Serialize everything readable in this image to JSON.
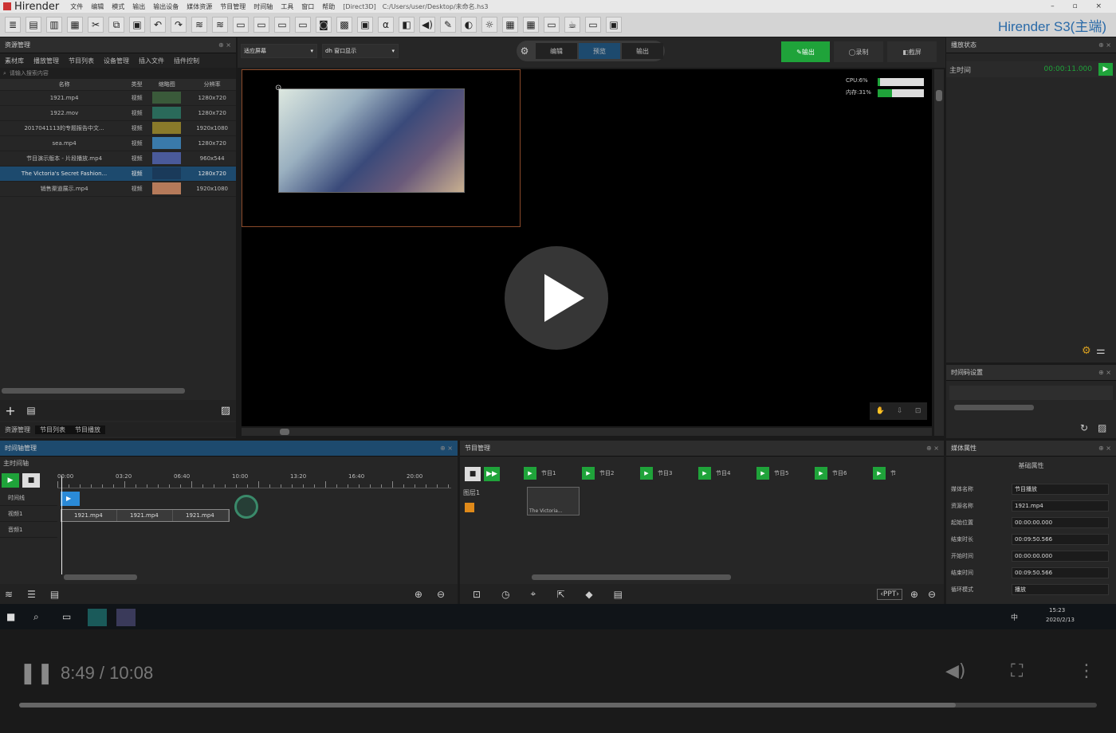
{
  "window": {
    "app_name": "Hirender",
    "menu": [
      "文件",
      "编辑",
      "模式",
      "输出",
      "输出设备",
      "媒体资源",
      "节目管理",
      "时间轴",
      "工具",
      "窗口",
      "帮助"
    ],
    "renderer": "[Direct3D]",
    "path": "C:/Users/user/Desktop/未命名.hs3",
    "controls": "–  ▫  ×"
  },
  "toolbar": {
    "brand": "Hirender S3(主端)",
    "icons": [
      "≣",
      "▤",
      "▥",
      "▦",
      "✂",
      "⧉",
      "▣",
      "↶",
      "↷",
      "≋",
      "≋",
      "▭",
      "▭",
      "▭",
      "▭",
      "◙",
      "▩",
      "▣",
      "α",
      "◧",
      "◀)",
      "✎",
      "◐",
      "☼",
      "▦",
      "▦",
      "▭",
      "☕",
      "▭",
      "▣"
    ]
  },
  "media_panel": {
    "title": "资源管理",
    "tabs": [
      "素材库",
      "播放管理",
      "节目列表",
      "设备管理",
      "插入文件",
      "插件控制"
    ],
    "search_placeholder": "请输入搜索内容",
    "columns": [
      "名称",
      "类型",
      "缩略图",
      "分辨率"
    ],
    "rows": [
      {
        "name": "1921.mp4",
        "type": "视频",
        "res": "1280x720",
        "color": "#3a5a3a"
      },
      {
        "name": "1922.mov",
        "type": "视频",
        "res": "1280x720",
        "color": "#2a6a5a"
      },
      {
        "name": "2017041113的专题报告中文...",
        "type": "视频",
        "res": "1920x1080",
        "color": "#8a7a2a"
      },
      {
        "name": "sea.mp4",
        "type": "视频",
        "res": "1280x720",
        "color": "#3a7aaa"
      },
      {
        "name": "节目演示版本 - 片段播放.mp4",
        "type": "视频",
        "res": "960x544",
        "color": "#4a5a9a"
      },
      {
        "name": "The Victoria's Secret Fashion...",
        "type": "视频",
        "res": "1280x720",
        "color": "#1a3a5a"
      },
      {
        "name": "销售渠道展示.mp4",
        "type": "视频",
        "res": "1920x1080",
        "color": "#b57a5a"
      }
    ],
    "bottom_tabs": [
      "资源管理",
      "节目列表",
      "节目播放"
    ]
  },
  "preview": {
    "mode_left": "适应屏幕",
    "mode_right": "dh 窗口显示",
    "tabs": [
      "编辑",
      "预览",
      "输出"
    ],
    "active_tab": "预览",
    "go_button": "输出",
    "record_button": "录制",
    "screenshot_button": "截屏",
    "cpu_label": "CPU:6%",
    "gpu_label": "内存:31%",
    "cpu_pct": 6,
    "gpu_pct": 31
  },
  "playback_state": {
    "title": "播放状态",
    "row_label": "主时间",
    "timecode": "00:00:11.000"
  },
  "timeline": {
    "title": "时间轴管理",
    "subtitle": "主时间轴",
    "ruler": [
      "00:00",
      "03:20",
      "06:40",
      "10:00",
      "13:20",
      "16:40",
      "20:00"
    ],
    "tracks": [
      "时间线",
      "视频1",
      "音频1"
    ],
    "clips": [
      "1921.mp4",
      "1921.mp4",
      "1921.mp4"
    ]
  },
  "show_panel": {
    "title": "节目管理",
    "tracks": [
      "节目1",
      "节目2",
      "节目3",
      "节目4",
      "节目5",
      "节目6",
      "节"
    ],
    "layer": "图层1",
    "clip": "The Victoria..."
  },
  "props": {
    "title": "媒体属性",
    "header": "基础属性",
    "fields": [
      {
        "label": "媒体名称",
        "value": "节目播放"
      },
      {
        "label": "资源名称",
        "value": "1921.mp4"
      },
      {
        "label": "起始位置",
        "value": "00:00:00.000"
      },
      {
        "label": "结束时长",
        "value": "00:09:50.566"
      },
      {
        "label": "开始时间",
        "value": "00:00:00.000"
      },
      {
        "label": "结束时间",
        "value": "00:09:50.566"
      },
      {
        "label": "循环模式",
        "value": "播放"
      }
    ]
  },
  "sync_panel": {
    "title": "时间码设置"
  },
  "taskbar": {
    "time": "15:23",
    "date": "2020/2/13",
    "ime": "中"
  },
  "video": {
    "time": "8:49 / 10:08",
    "progress": 0.869
  }
}
